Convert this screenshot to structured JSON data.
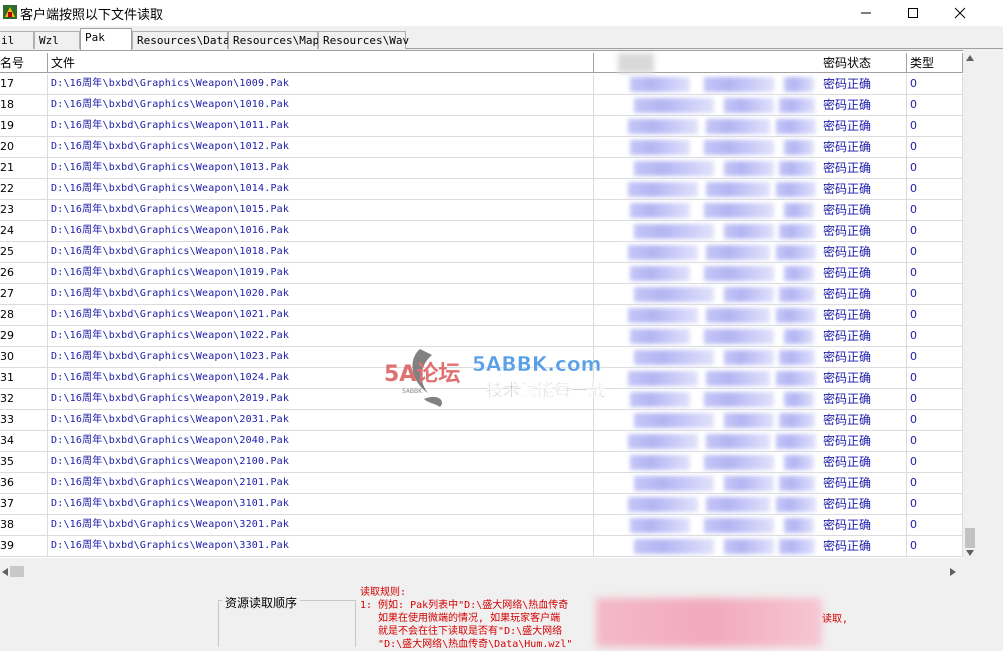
{
  "window": {
    "title": "客户端按照以下文件读取"
  },
  "tabs": [
    {
      "label": "il",
      "active": false
    },
    {
      "label": "Wzl",
      "active": false
    },
    {
      "label": "Pak",
      "active": true
    },
    {
      "label": "Resources\\Data",
      "active": false
    },
    {
      "label": "Resources\\Map",
      "active": false
    },
    {
      "label": "Resources\\Wav",
      "active": false
    }
  ],
  "table": {
    "headers": {
      "id": "名号",
      "file": "文件",
      "status": "密码状态",
      "type": "类型"
    },
    "rows": [
      {
        "id": "17",
        "file": "D:\\16周年\\bxbd\\Graphics\\Weapon\\1009.Pak",
        "status": "密码正确",
        "type": "0"
      },
      {
        "id": "18",
        "file": "D:\\16周年\\bxbd\\Graphics\\Weapon\\1010.Pak",
        "status": "密码正确",
        "type": "0"
      },
      {
        "id": "19",
        "file": "D:\\16周年\\bxbd\\Graphics\\Weapon\\1011.Pak",
        "status": "密码正确",
        "type": "0"
      },
      {
        "id": "20",
        "file": "D:\\16周年\\bxbd\\Graphics\\Weapon\\1012.Pak",
        "status": "密码正确",
        "type": "0"
      },
      {
        "id": "21",
        "file": "D:\\16周年\\bxbd\\Graphics\\Weapon\\1013.Pak",
        "status": "密码正确",
        "type": "0"
      },
      {
        "id": "22",
        "file": "D:\\16周年\\bxbd\\Graphics\\Weapon\\1014.Pak",
        "status": "密码正确",
        "type": "0"
      },
      {
        "id": "23",
        "file": "D:\\16周年\\bxbd\\Graphics\\Weapon\\1015.Pak",
        "status": "密码正确",
        "type": "0"
      },
      {
        "id": "24",
        "file": "D:\\16周年\\bxbd\\Graphics\\Weapon\\1016.Pak",
        "status": "密码正确",
        "type": "0"
      },
      {
        "id": "25",
        "file": "D:\\16周年\\bxbd\\Graphics\\Weapon\\1018.Pak",
        "status": "密码正确",
        "type": "0"
      },
      {
        "id": "26",
        "file": "D:\\16周年\\bxbd\\Graphics\\Weapon\\1019.Pak",
        "status": "密码正确",
        "type": "0"
      },
      {
        "id": "27",
        "file": "D:\\16周年\\bxbd\\Graphics\\Weapon\\1020.Pak",
        "status": "密码正确",
        "type": "0"
      },
      {
        "id": "28",
        "file": "D:\\16周年\\bxbd\\Graphics\\Weapon\\1021.Pak",
        "status": "密码正确",
        "type": "0"
      },
      {
        "id": "29",
        "file": "D:\\16周年\\bxbd\\Graphics\\Weapon\\1022.Pak",
        "status": "密码正确",
        "type": "0"
      },
      {
        "id": "30",
        "file": "D:\\16周年\\bxbd\\Graphics\\Weapon\\1023.Pak",
        "status": "密码正确",
        "type": "0"
      },
      {
        "id": "31",
        "file": "D:\\16周年\\bxbd\\Graphics\\Weapon\\1024.Pak",
        "status": "密码正确",
        "type": "0"
      },
      {
        "id": "32",
        "file": "D:\\16周年\\bxbd\\Graphics\\Weapon\\2019.Pak",
        "status": "密码正确",
        "type": "0"
      },
      {
        "id": "33",
        "file": "D:\\16周年\\bxbd\\Graphics\\Weapon\\2031.Pak",
        "status": "密码正确",
        "type": "0"
      },
      {
        "id": "34",
        "file": "D:\\16周年\\bxbd\\Graphics\\Weapon\\2040.Pak",
        "status": "密码正确",
        "type": "0"
      },
      {
        "id": "35",
        "file": "D:\\16周年\\bxbd\\Graphics\\Weapon\\2100.Pak",
        "status": "密码正确",
        "type": "0"
      },
      {
        "id": "36",
        "file": "D:\\16周年\\bxbd\\Graphics\\Weapon\\2101.Pak",
        "status": "密码正确",
        "type": "0"
      },
      {
        "id": "37",
        "file": "D:\\16周年\\bxbd\\Graphics\\Weapon\\3101.Pak",
        "status": "密码正确",
        "type": "0"
      },
      {
        "id": "38",
        "file": "D:\\16周年\\bxbd\\Graphics\\Weapon\\3201.Pak",
        "status": "密码正确",
        "type": "0"
      },
      {
        "id": "39",
        "file": "D:\\16周年\\bxbd\\Graphics\\Weapon\\3301.Pak",
        "status": "密码正确",
        "type": "0"
      }
    ]
  },
  "bottom": {
    "group_title": "资源读取顺序",
    "rules_lines": [
      "读取规则:",
      "1: 例如: Pak列表中\"D:\\盛大网络\\热血传奇",
      "   如果在使用微端的情况, 如果玩家客户端",
      "   就是不会在往下读取是否有\"D:\\盛大网络",
      "   \"D:\\盛大网络\\热血传奇\\Data\\Hum.wzl\""
    ],
    "rules_tail": "读取,"
  },
  "watermark": {
    "brand": "5A论坛",
    "brand_sub": "5ABBK",
    "site": "5ABBK.com",
    "slogan": "技术赋能每一战"
  },
  "colors": {
    "link_blue": "#1a1aa8",
    "rule_red": "#d40000"
  }
}
